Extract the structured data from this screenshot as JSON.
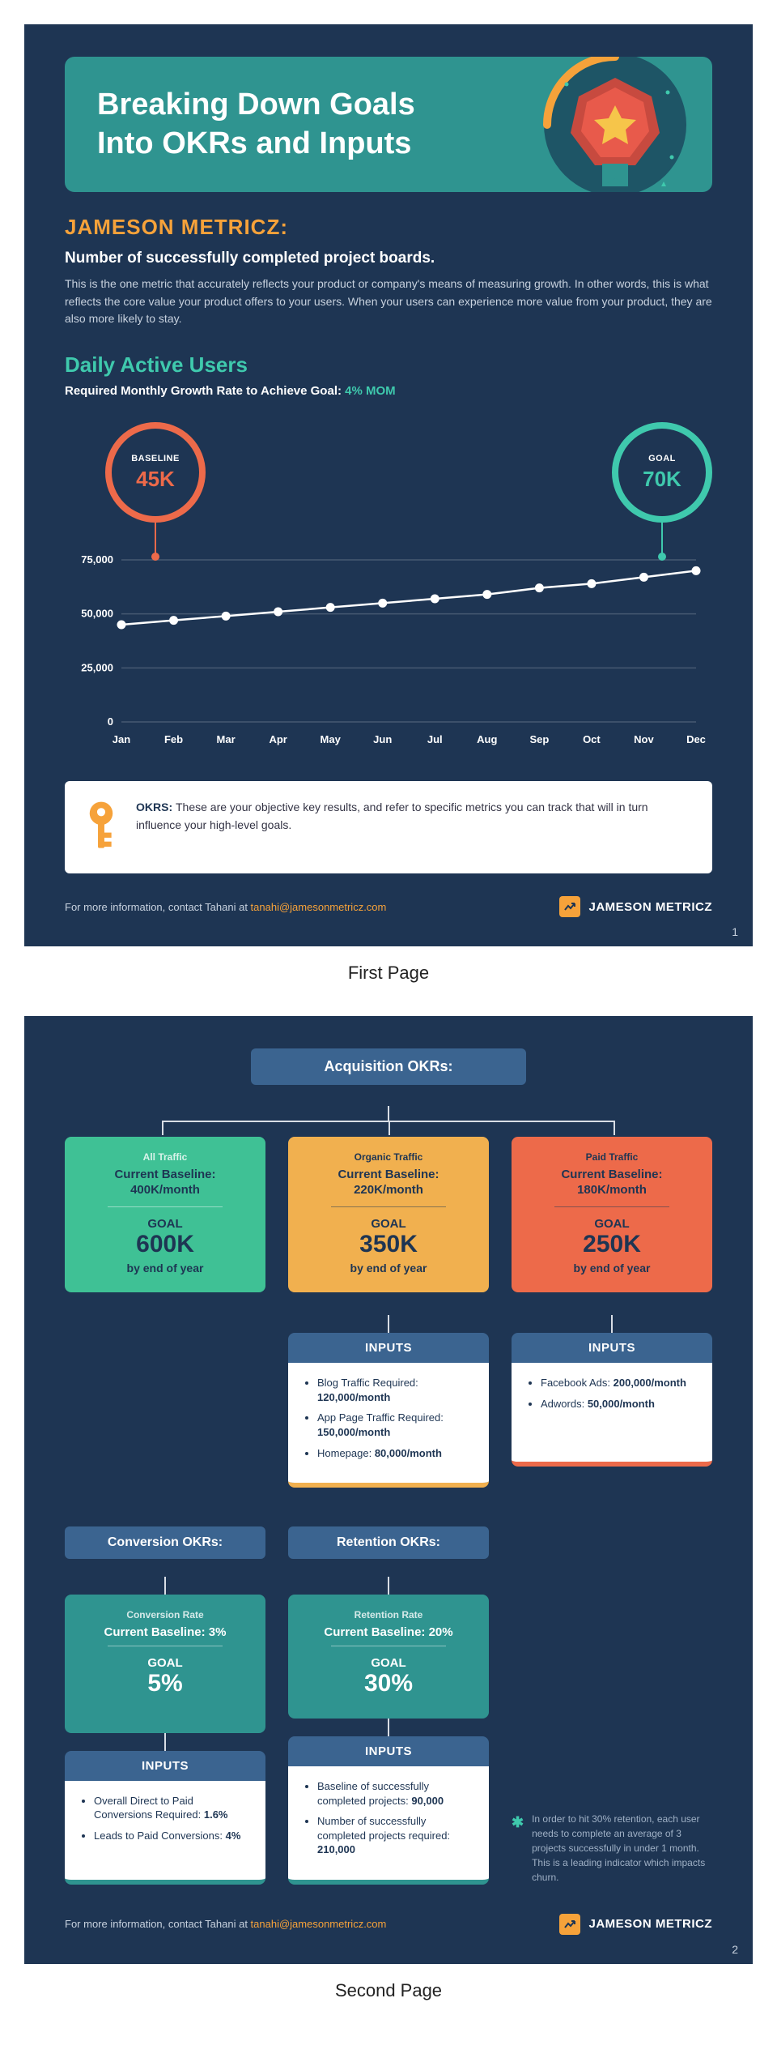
{
  "page1": {
    "hero_title_line1": "Breaking Down Goals",
    "hero_title_line2": "Into OKRs and Inputs",
    "section1_title": "JAMESON METRICZ:",
    "section1_sub": "Number of successfully completed project boards.",
    "section1_body": "This is the one metric that accurately reflects your product or company's means of measuring growth. In other words, this is what reflects the core value your product offers to your users. When your users can experience more value from your product, they are also more likely to stay.",
    "dau_title": "Daily Active Users",
    "growth_label": "Required Monthly Growth Rate to Achieve Goal: ",
    "growth_value": "4% MOM",
    "baseline_label": "BASELINE",
    "baseline_value": "45K",
    "goal_label": "GOAL",
    "goal_value": "70K",
    "okrs_label": "OKRS: ",
    "okrs_text": "These are your objective key results, and refer to specific metrics you can track that will in turn influence your high-level goals.",
    "footer_contact": "For more information, contact  Tahani at ",
    "footer_email": "tanahi@jamesonmetricz.com",
    "brand_name": "JAMESON METRICZ",
    "page_num": "1",
    "page_label": "First Page"
  },
  "chart_data": {
    "type": "line",
    "categories": [
      "Jan",
      "Feb",
      "Mar",
      "Apr",
      "May",
      "Jun",
      "Jul",
      "Aug",
      "Sep",
      "Oct",
      "Nov",
      "Dec"
    ],
    "values": [
      45000,
      47000,
      49000,
      51000,
      53000,
      55000,
      57000,
      59000,
      62000,
      64000,
      67000,
      70000
    ],
    "y_ticks": [
      0,
      25000,
      50000,
      75000
    ],
    "y_tick_labels": [
      "0",
      "25,000",
      "50,000",
      "75,000"
    ],
    "ylim": [
      0,
      75000
    ]
  },
  "page2": {
    "acq_header": "Acquisition OKRs:",
    "cards": {
      "all": {
        "tag": "All Traffic",
        "baseline_label": "Current Baseline:",
        "baseline_value": "400K/month",
        "goal_label": "GOAL",
        "goal_value": "600K",
        "goal_by": "by end of year"
      },
      "organic": {
        "tag": "Organic Traffic",
        "baseline_label": "Current Baseline:",
        "baseline_value": "220K/month",
        "goal_label": "GOAL",
        "goal_value": "350K",
        "goal_by": "by end of year"
      },
      "paid": {
        "tag": "Paid Traffic",
        "baseline_label": "Current Baseline:",
        "baseline_value": "180K/month",
        "goal_label": "GOAL",
        "goal_value": "250K",
        "goal_by": "by end of year"
      }
    },
    "inputs_label": "INPUTS",
    "inputs_organic": [
      {
        "text": "Blog Traffic Required:",
        "bold": "120,000/month"
      },
      {
        "text": "App Page Traffic Required:",
        "bold": "150,000/month"
      },
      {
        "text": "Homepage:",
        "bold": "80,000/month"
      }
    ],
    "inputs_paid": [
      {
        "text": "Facebook Ads:",
        "bold": "200,000/month"
      },
      {
        "text": "Adwords:",
        "bold": "50,000/month"
      }
    ],
    "conv_header": "Conversion OKRs:",
    "conv_card": {
      "tag": "Conversion Rate",
      "baseline_label": "Current Baseline: 3%",
      "goal_label": "GOAL",
      "goal_value": "5%"
    },
    "inputs_conv": [
      {
        "text": "Overall Direct to Paid Conversions Required:",
        "bold": "1.6%"
      },
      {
        "text": "Leads to Paid Conversions:",
        "bold": "4%"
      }
    ],
    "ret_header": "Retention OKRs:",
    "ret_card": {
      "tag": "Retention Rate",
      "baseline_label": "Current Baseline: 20%",
      "goal_label": "GOAL",
      "goal_value": "30%"
    },
    "inputs_ret": [
      {
        "text": "Baseline of successfully completed projects:",
        "bold": "90,000"
      },
      {
        "text": "Number of successfully completed projects required:",
        "bold": "210,000"
      }
    ],
    "note": "In order to hit 30% retention, each user needs to complete an average of 3 projects successfully in under 1 month. This is a leading indicator which impacts churn.",
    "footer_contact": "For more information, contact  Tahani at ",
    "footer_email": "tanahi@jamesonmetricz.com",
    "brand_name": "JAMESON METRICZ",
    "page_num": "2",
    "page_label": "Second Page"
  }
}
